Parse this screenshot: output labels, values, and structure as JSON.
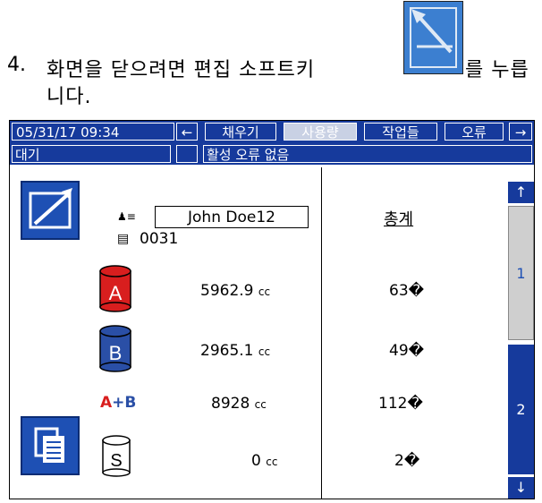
{
  "instruction": {
    "number": "4.",
    "line1": "화면을 닫으려면 편집 소프트키",
    "suffix": "를 누릅",
    "line2": "니다."
  },
  "status_bar": {
    "datetime": "05/31/17 09:34",
    "left_arrow": "←",
    "tabs": [
      {
        "label": "채우기",
        "active": false
      },
      {
        "label": "사용량",
        "active": true
      },
      {
        "label": "작업들",
        "active": false
      },
      {
        "label": "오류",
        "active": false
      }
    ],
    "right_arrow": "→",
    "state": "대기",
    "error_message": "활성 오류 없음"
  },
  "job": {
    "user": "John Doe12",
    "job_number": "0031"
  },
  "totals_header": "총계",
  "materials": [
    {
      "label": "A",
      "amount": "5962.9",
      "unit": "cc",
      "total": "63",
      "total_suffix": "�"
    },
    {
      "label": "B",
      "amount": "2965.1",
      "unit": "cc",
      "total": "49",
      "total_suffix": "�"
    },
    {
      "label": "A+B",
      "amount": "8928",
      "unit": "cc",
      "total": "112",
      "total_suffix": "�"
    },
    {
      "label": "S",
      "amount": "0",
      "unit": "cc",
      "total": "2",
      "total_suffix": "�"
    }
  ],
  "pager": {
    "up": "↑",
    "page1": "1",
    "page2": "2",
    "down": "↓"
  },
  "colors": {
    "screen_blue": "#163a9c",
    "button_blue": "#1e50b4",
    "material_a": "#d81e1e",
    "material_b": "#2a4fa6"
  }
}
